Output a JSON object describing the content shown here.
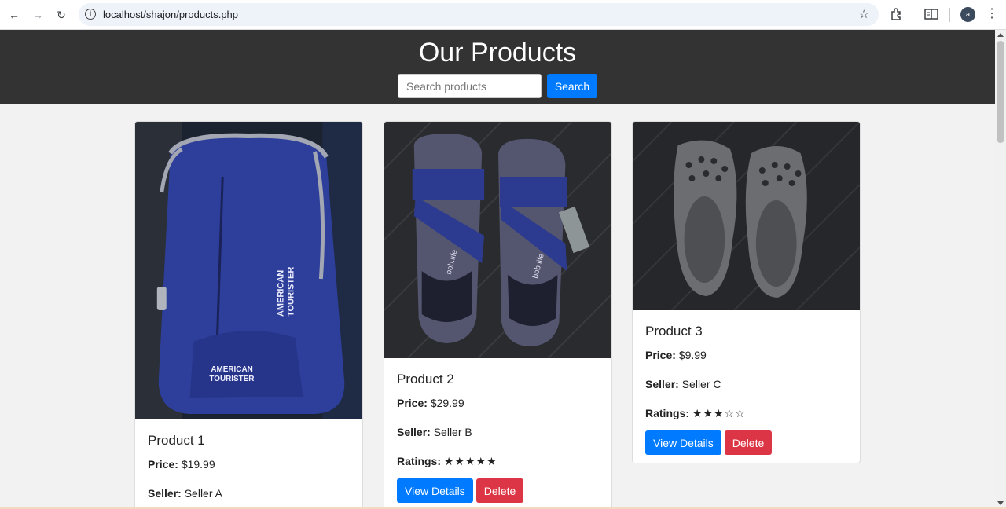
{
  "browser": {
    "url": "localhost/shajon/products.php",
    "avatar_letter": "a"
  },
  "header": {
    "title": "Our Products",
    "search_placeholder": "Search products",
    "search_button": "Search"
  },
  "labels": {
    "price": "Price:",
    "seller": "Seller:",
    "ratings": "Ratings:",
    "view_details": "View Details",
    "delete": "Delete"
  },
  "products": [
    {
      "name": "Product 1",
      "price": "$19.99",
      "seller": "Seller A",
      "image": "blue backpack",
      "brand_text": "AMERICAN TOURISTER"
    },
    {
      "name": "Product 2",
      "price": "$29.99",
      "seller": "Seller B",
      "ratings": "★★★★★",
      "image": "navy sandals",
      "brand_text": "bob.life"
    },
    {
      "name": "Product 3",
      "price": "$9.99",
      "seller": "Seller C",
      "ratings": "★★★☆☆",
      "image": "grey clogs"
    }
  ],
  "colors": {
    "header_bg": "#333333",
    "primary": "#007bff",
    "danger": "#dc3545"
  }
}
